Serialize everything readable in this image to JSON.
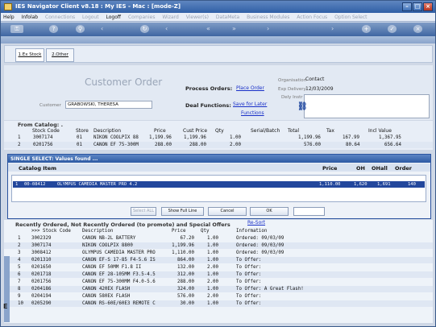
{
  "window": {
    "title": "IES Navigator Client v8.18 : My IES - Mac :         [mode-Z]"
  },
  "menu": [
    "Help",
    "Infolab",
    "Connections",
    "Logout",
    "Logoff",
    "Companies",
    "Wizard",
    "Viewer(s)",
    "DataMeta",
    "Business Modules",
    "Action Focus",
    "Option Select"
  ],
  "tabs": {
    "ex_stock": "1.Ex Stock",
    "other": "2.Other"
  },
  "order": {
    "title": "Customer Order",
    "customer_label": "Customer",
    "customer_value": "GRABOWSKI, THERESA",
    "process_label": "Process Orders:",
    "place_order": "Place Order",
    "deal_label": "Deal Functions:",
    "save_later": "Save for Later",
    "functions": "Functions",
    "org_label": "Organisation",
    "org_value": "Contact",
    "exp_label": "Exp Delivery",
    "exp_value": "12/03/2009",
    "dely_label": "Dely Instr"
  },
  "catalog": {
    "title": "From Catalog: .",
    "headers": [
      "Stock Code",
      "Store",
      "Description",
      "Price",
      "Cust Price",
      "Qty",
      "Serial/Batch",
      "Total",
      "Tax",
      "Incl Value"
    ],
    "rows": [
      [
        "1",
        "3007174",
        "01",
        "NIKON COOLPIX 88",
        "1,199.96",
        "1,199.96",
        "1.00",
        "1,199.96",
        "167.99",
        "1,367.95"
      ],
      [
        "2",
        "0201756",
        "01",
        "CANON EF 75-300M",
        "288.00",
        "288.00",
        "2.00",
        "576.00",
        "80.64",
        "656.64"
      ]
    ]
  },
  "dialog": {
    "title": "SINGLE SELECT: Values found  ...",
    "headers": {
      "catalog_item": "Catalog Item",
      "price": "Price",
      "oh": "OH",
      "ohall": "OHall",
      "order": "Order"
    },
    "selected": {
      "num": "1",
      "code": "00-08412",
      "desc": "OLYMPUS CAMEDIA MASTER PRO 4.2",
      "price": "1,110.00",
      "oh": "1,620",
      "ohall": "1,691",
      "order": "140"
    },
    "buttons": {
      "select_all": "Select ALL",
      "show_full": "Show Full Line",
      "cancel": "Cancel",
      "ok": "OK"
    }
  },
  "recent": {
    "title": "Recently Ordered, Not Recently Ordered (to promote) and Special Offers",
    "reset": "Re-Sort",
    "headers": [
      ">>> Stock Code",
      "Description",
      "Price",
      "Qty",
      "Information"
    ],
    "rows": [
      [
        "1",
        "3002329",
        "CANON NB-2L BATTERY",
        "67.20",
        "1.00",
        "Ordered: 09/03/09"
      ],
      [
        "2",
        "3007174",
        "NIKON COOLPIX 8800",
        "1,199.96",
        "1.00",
        "Ordered: 09/03/09"
      ],
      [
        "3",
        "3008412",
        "OLYMPUS CAMEDIA MASTER PRO",
        "1,110.00",
        "1.00",
        "Ordered: 09/03/09"
      ],
      [
        "4",
        "0201310",
        "CANON EF-S 17-85 F4-5.6 IS",
        "864.00",
        "1.00",
        "To Offer:"
      ],
      [
        "5",
        "0201650",
        "CANON EF 50MM F1.8 II",
        "132.00",
        "2.00",
        "To Offer:"
      ],
      [
        "6",
        "0201718",
        "CANON EF 28-105MM F3.5-4.5",
        "312.00",
        "1.00",
        "To Offer:"
      ],
      [
        "7",
        "0201756",
        "CANON EF 75-300MM F4.0-5.6",
        "288.00",
        "2.00",
        "To Offer:"
      ],
      [
        "8",
        "0204186",
        "CANON 420EX FLASH",
        "324.00",
        "1.00",
        "To Offer: A Great Flash!"
      ],
      [
        "9",
        "0204194",
        "CANON 580EX FLASH",
        "576.00",
        "2.00",
        "To Offer:"
      ],
      [
        "10",
        "0205290",
        "CANON RS-60E/60E3 REMOTE C",
        "30.00",
        "1.00",
        "To Offer:"
      ]
    ]
  }
}
